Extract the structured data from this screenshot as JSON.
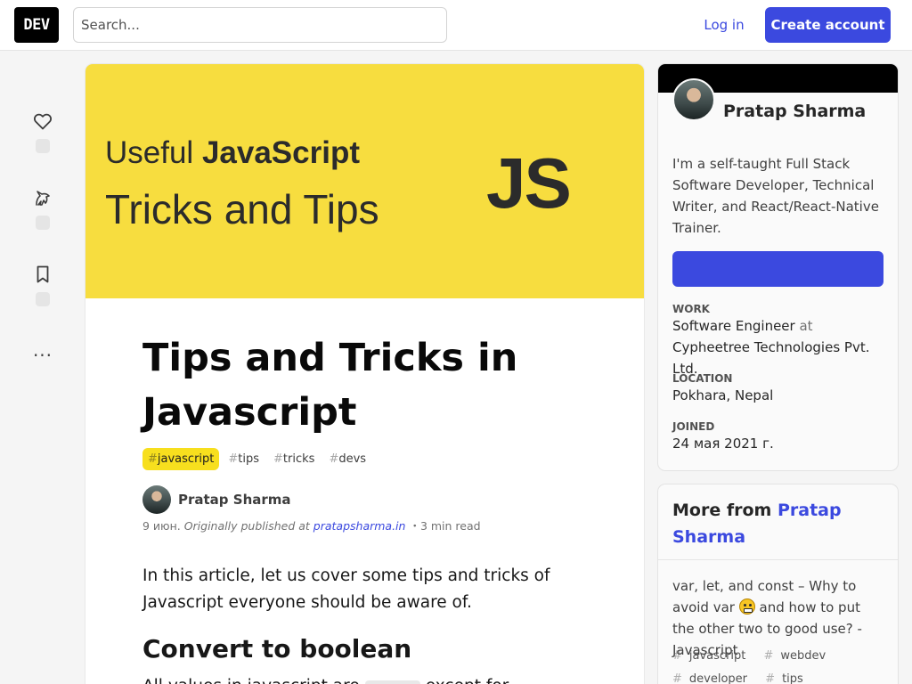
{
  "header": {
    "logo": "DEV",
    "search_placeholder": "Search...",
    "login_label": "Log in",
    "create_account_label": "Create account"
  },
  "colors": {
    "brand": "#3b49df",
    "tag_highlight": "#f7df1e",
    "cover_background": "#f7dd3f"
  },
  "reactions": {
    "icons": [
      "heart-icon",
      "unicorn-icon",
      "bookmark-icon",
      "more-horizontal-icon"
    ],
    "more_label": "..."
  },
  "article": {
    "cover": {
      "line1_prefix": "Useful ",
      "line1_bold": "JavaScript",
      "line2": "Tricks and Tips",
      "badge": "JS"
    },
    "title": "Tips and Tricks in Javascript",
    "tags": [
      {
        "hash": "#",
        "name": "javascript"
      },
      {
        "hash": "#",
        "name": "tips"
      },
      {
        "hash": "#",
        "name": "tricks"
      },
      {
        "hash": "#",
        "name": "devs"
      }
    ],
    "author": "Pratap Sharma",
    "date": "9 июн.",
    "published_prefix": "Originally published at",
    "published_site": "pratapsharma.in",
    "read_time": "・3 min read",
    "intro": "In this article, let us cover some tips and tricks of Javascript everyone should be aware of.",
    "section_heading": "Convert to boolean",
    "next_line_start": "All values in javascript are",
    "next_line_mid": "except for"
  },
  "profile": {
    "name": "Pratap Sharma",
    "bio": "I'm a self-taught Full Stack Software Developer, Technical Writer, and React/React-Native Trainer.",
    "follow_label": "",
    "work_label": "Work",
    "work_value": "Software Engineer",
    "work_at": "at",
    "work_company": "Cypheetree Technologies Pvt. Ltd.",
    "location_label": "Location",
    "location_value": "Pokhara, Nepal",
    "joined_label": "Joined",
    "joined_value": "24 мая 2021 г."
  },
  "more_from": {
    "heading_prefix": "More from",
    "heading_name": "Pratap Sharma",
    "post_title_a": "var, let, and const – Why to avoid var",
    "post_title_b": "and how to put the other two to good use? - Javascript",
    "post_tags": [
      {
        "hash": "#",
        "name": "javascript"
      },
      {
        "hash": "#",
        "name": "webdev"
      },
      {
        "hash": "#",
        "name": "developer"
      },
      {
        "hash": "#",
        "name": "tips"
      }
    ]
  }
}
